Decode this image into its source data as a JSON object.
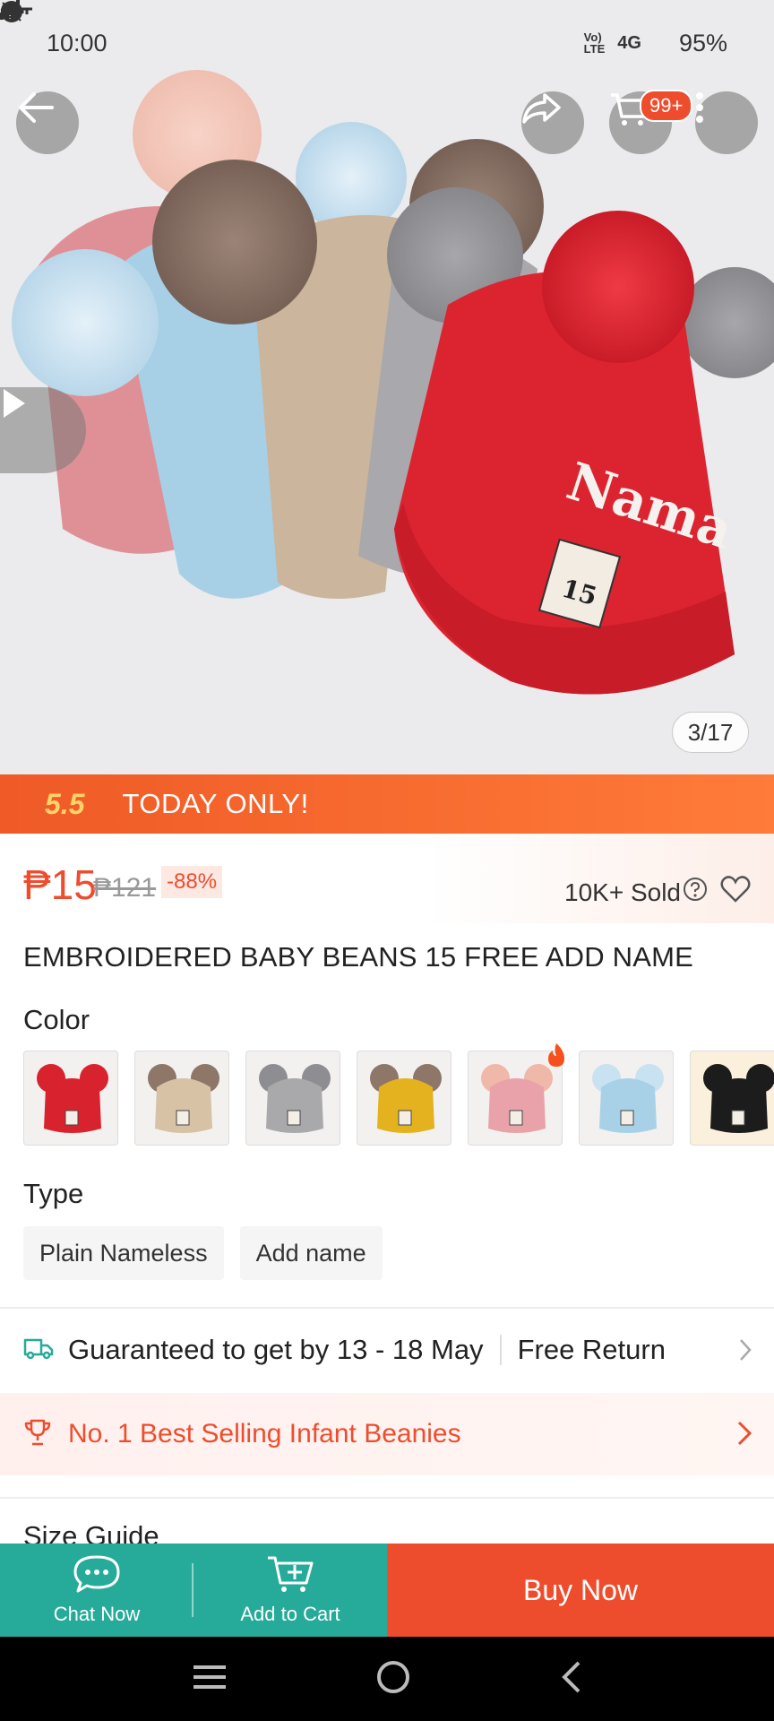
{
  "status_bar": {
    "time": "10:00",
    "battery": "95%",
    "network": "4G"
  },
  "gallery": {
    "counter": "3/17",
    "hat_label": "Nama",
    "tag_text": "15",
    "cart_badge": "99+"
  },
  "promo": {
    "badge": "5.5",
    "text": "TODAY ONLY!"
  },
  "price": {
    "current": "₱15",
    "original": "₱121",
    "discount": "-88%",
    "sold": "10K+ Sold"
  },
  "product": {
    "title": "EMBROIDERED BABY BEANS 15 FREE ADD NAME"
  },
  "color": {
    "label": "Color",
    "swatches": [
      {
        "name": "red",
        "hat": "#d8232f",
        "pom": "#d8232f"
      },
      {
        "name": "khaki",
        "hat": "#d7c2a6",
        "pom": "#8e7668"
      },
      {
        "name": "gray",
        "hat": "#a9a9ab",
        "pom": "#8e8e92"
      },
      {
        "name": "yellow",
        "hat": "#e3b21e",
        "pom": "#8e7668"
      },
      {
        "name": "pink",
        "hat": "#e9a2a9",
        "pom": "#f0b8a8"
      },
      {
        "name": "light-blue",
        "hat": "#a8d1e8",
        "pom": "#c9e2f1"
      },
      {
        "name": "black",
        "hat": "#1c1c1c",
        "pom": "#1c1c1c"
      }
    ]
  },
  "type": {
    "label": "Type",
    "options": [
      "Plain Nameless",
      "Add name"
    ]
  },
  "shipping": {
    "text": "Guaranteed to get by 13 - 18 May",
    "return": "Free Return"
  },
  "bestselling": {
    "text": "No. 1 Best Selling Infant Beanies"
  },
  "size_guide": {
    "label": "Size Guide"
  },
  "actions": {
    "chat": "Chat Now",
    "cart": "Add to Cart",
    "buy": "Buy Now"
  },
  "colors": {
    "accent": "#ee4d2d",
    "teal": "#26aa99"
  }
}
